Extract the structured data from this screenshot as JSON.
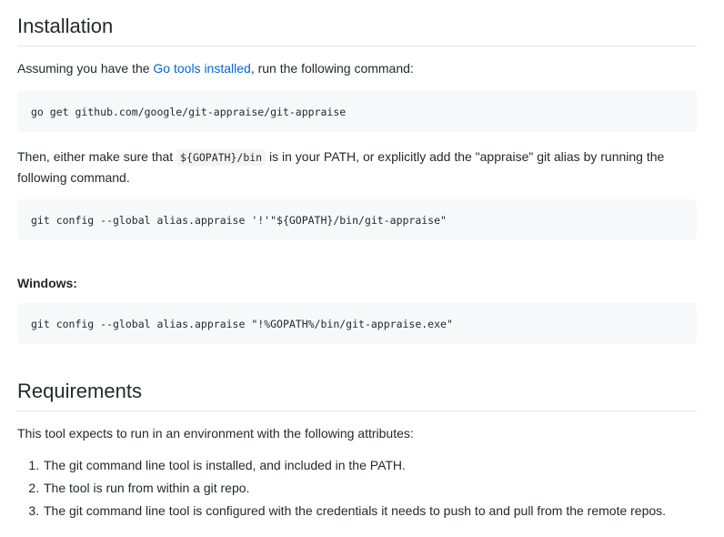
{
  "installation": {
    "title": "Installation",
    "intro_before": "Assuming you have the ",
    "intro_link": "Go tools installed",
    "intro_after": ", run the following command:",
    "code1": "go get github.com/google/git-appraise/git-appraise",
    "then_before": "Then, either make sure that ",
    "then_code": "${GOPATH}/bin",
    "then_after": " is in your PATH, or explicitly add the \"appraise\" git alias by running the following command.",
    "code2": "git config --global alias.appraise '!'\"${GOPATH}/bin/git-appraise\"",
    "windows_label": "Windows:",
    "code3": "git config --global alias.appraise \"!%GOPATH%/bin/git-appraise.exe\""
  },
  "requirements": {
    "title": "Requirements",
    "intro": "This tool expects to run in an environment with the following attributes:",
    "items": [
      "The git command line tool is installed, and included in the PATH.",
      "The tool is run from within a git repo.",
      "The git command line tool is configured with the credentials it needs to push to and pull from the remote repos."
    ]
  }
}
